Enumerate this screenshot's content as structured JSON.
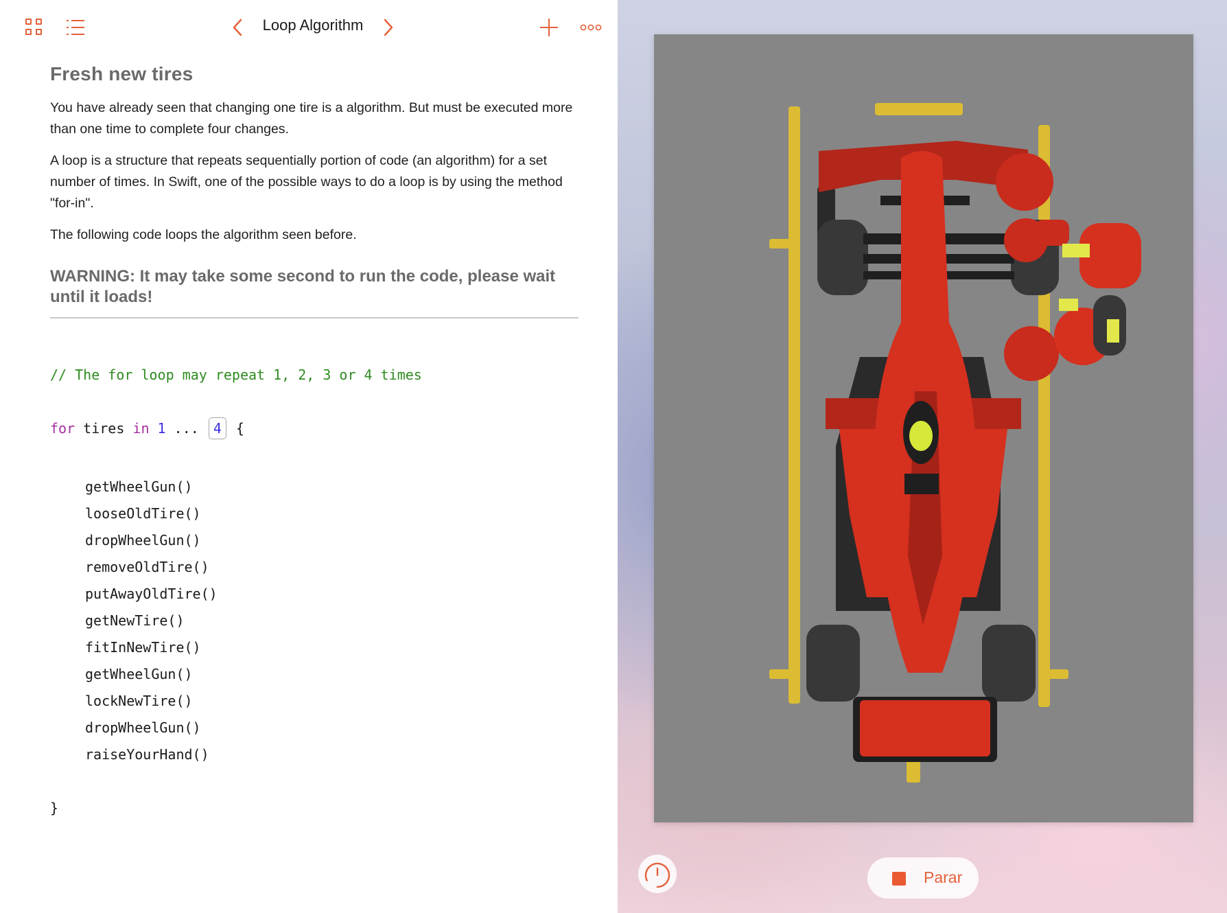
{
  "toolbar": {
    "title": "Loop Algorithm"
  },
  "content": {
    "heading": "Fresh new tires",
    "paragraphs": [
      "You have already seen that changing one tire is a algorithm. But must be executed more than one time to complete four changes.",
      "A loop is a structure that repeats sequentially portion of code (an algorithm) for a set number of times. In Swift, one of the possible ways to do a loop is by using the method \"for-in\".",
      "The following code loops the algorithm seen before."
    ],
    "warning": "WARNING: It may take some second to run the code, please wait until it loads!"
  },
  "code": {
    "comment": "// The for loop may repeat 1, 2, 3 or 4 times",
    "for_keyword": "for",
    "loop_var": " tires ",
    "in_keyword": "in",
    "range_start": " 1",
    "range_op": " ... ",
    "range_end": "4",
    "open_brace": " {",
    "body": [
      "getWheelGun()",
      "looseOldTire()",
      "dropWheelGun()",
      "removeOldTire()",
      "putAwayOldTire()",
      "getNewTire()",
      "fitInNewTire()",
      "getWheelGun()",
      "lockNewTire()",
      "dropWheelGun()",
      "raiseYourHand()"
    ],
    "close_brace": "}"
  },
  "live_view": {
    "stop_label": "Parar"
  },
  "colors": {
    "accent": "#e4613b",
    "comment": "#2e8b20",
    "keyword": "#a22f9e",
    "number": "#3a2ee0",
    "car_red": "#d6301f",
    "line_yellow": "#e3c12c",
    "asphalt": "#858585"
  },
  "icons": [
    "grid-icon",
    "list-icon",
    "chevron-left-icon",
    "chevron-right-icon",
    "plus-icon",
    "more-icon",
    "gauge-icon",
    "stop-icon"
  ]
}
